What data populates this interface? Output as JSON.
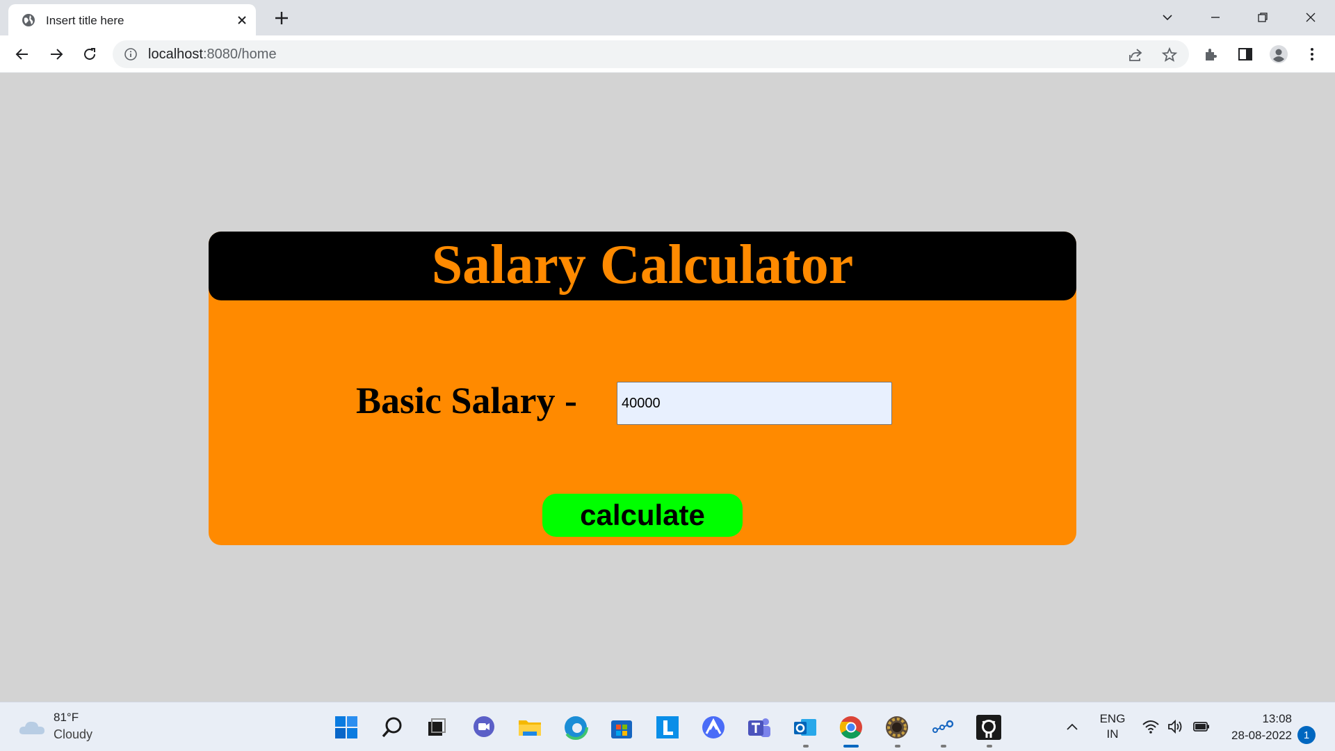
{
  "browser": {
    "tab_title": "Insert title here",
    "url_host": "localhost",
    "url_path": ":8080/home"
  },
  "page": {
    "heading": "Salary Calculator",
    "salary_label": "Basic Salary -",
    "salary_value": "40000",
    "calculate_label": "calculate"
  },
  "taskbar": {
    "weather_temp": "81°F",
    "weather_condition": "Cloudy",
    "lang_line1": "ENG",
    "lang_line2": "IN",
    "time": "13:08",
    "date": "28-08-2022",
    "notification_count": "1",
    "apps": [
      "start-icon",
      "search-icon",
      "task-view-icon",
      "chat-icon",
      "file-explorer-icon",
      "edge-icon",
      "store-icon",
      "l-app-icon",
      "arc-app-icon",
      "teams-icon",
      "outlook-icon",
      "chrome-icon",
      "gear-app-icon",
      "network-app-icon",
      "github-icon"
    ]
  },
  "colors": {
    "page_bg": "#d3d3d3",
    "card_bg": "#ff8a00",
    "header_bg": "#000000",
    "heading_color": "#ff8a00",
    "button_bg": "#00ff00",
    "input_bg": "#e8f0fe"
  }
}
